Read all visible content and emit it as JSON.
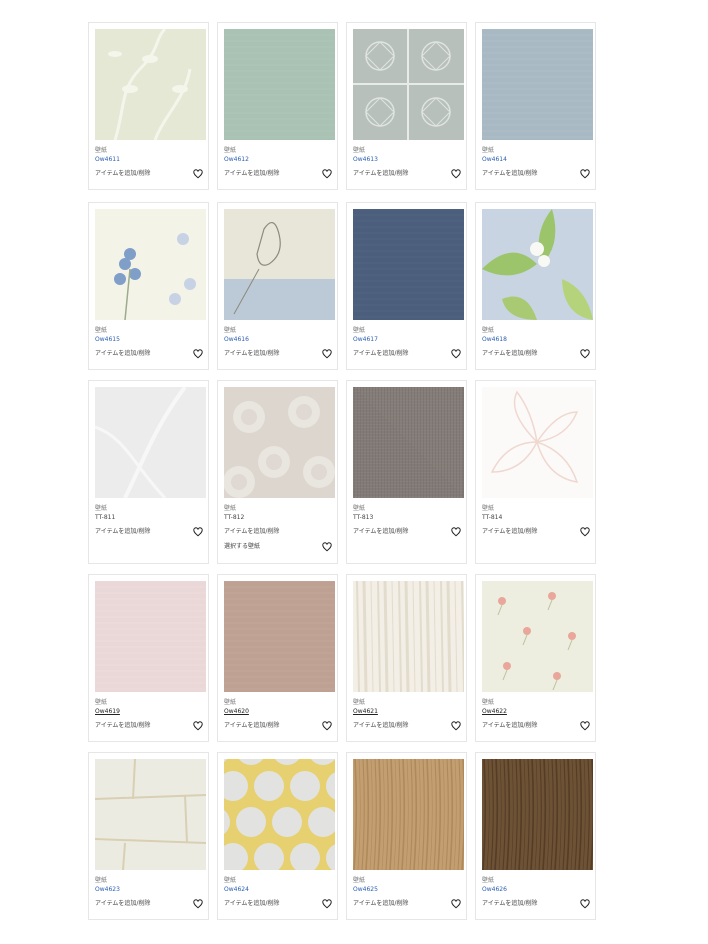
{
  "grid": {
    "rows": [
      [
        {
          "category": "壁紙",
          "code": "Ow4611",
          "name": "アイテムを追加/削除",
          "pattern": "vine",
          "bg": "#e4e8d4",
          "fg": "#f4f6ec"
        },
        {
          "category": "壁紙",
          "code": "Ow4612",
          "name": "アイテムを追加/削除",
          "pattern": "solid-sage",
          "bg": "#a9c2b4",
          "fg": "#b6cdbf"
        },
        {
          "category": "壁紙",
          "code": "Ow4613",
          "name": "アイテムを追加/削除",
          "pattern": "tile",
          "bg": "#b8c0bc",
          "fg": "#dfe4e0"
        },
        {
          "category": "壁紙",
          "code": "Ow4614",
          "name": "アイテムを追加/削除",
          "pattern": "solid-blue",
          "bg": "#a8b9c3",
          "fg": "#b4c4cd"
        }
      ],
      [
        {
          "category": "壁紙",
          "code": "Ow4615",
          "name": "アイテムを追加/削除",
          "pattern": "blue-flower",
          "bg": "#f4f3e8",
          "fg": "#7f9fc9"
        },
        {
          "category": "壁紙",
          "code": "Ow4616",
          "name": "アイテムを追加/削除",
          "pattern": "rabbit",
          "bg": "#e8e6d8",
          "fg": "#a9bcd6"
        },
        {
          "category": "壁紙",
          "code": "Ow4617",
          "name": "アイテムを追加/削除",
          "pattern": "solid-navy",
          "bg": "#4b5f7c",
          "fg": "#55698a"
        },
        {
          "category": "壁紙",
          "code": "Ow4618",
          "name": "アイテムを追加/削除",
          "pattern": "leaf",
          "bg": "#c8d4e2",
          "fg": "#9cc46a"
        }
      ],
      [
        {
          "category": "壁紙",
          "code": "TT-811",
          "name": "アイテムを追加/削除",
          "pattern": "faint",
          "bg": "#ececec",
          "fg": "#f7f7f7"
        },
        {
          "category": "壁紙",
          "code": "TT-812",
          "name": "アイテムを追加/削除",
          "extra": "選択する壁紙",
          "pattern": "damask",
          "bg": "#ddd6cf",
          "fg": "#ece8e2"
        },
        {
          "category": "壁紙",
          "code": "TT-813",
          "name": "アイテムを追加/削除",
          "pattern": "linen",
          "bg": "#807874",
          "fg": "#9a928d"
        },
        {
          "category": "壁紙",
          "code": "TT-814",
          "name": "アイテムを追加/削除",
          "pattern": "line-flower",
          "bg": "#fcfaf8",
          "fg": "#efd8d0"
        }
      ],
      [
        {
          "category": "壁紙",
          "code": "Ow4619",
          "name": "アイテムを追加/削除",
          "pattern": "solid-pink",
          "bg": "#ead8d8",
          "fg": "#f1e2e2"
        },
        {
          "category": "壁紙",
          "code": "Ow4620",
          "name": "アイテムを追加/削除",
          "pattern": "solid-mauve",
          "bg": "#bea193",
          "fg": "#c9ae9f"
        },
        {
          "category": "壁紙",
          "code": "Ow4621",
          "name": "アイテムを追加/削除",
          "pattern": "stripe",
          "bg": "#f3efe6",
          "fg": "#e2dccd"
        },
        {
          "category": "壁紙",
          "code": "Ow4622",
          "name": "アイテムを追加/削除",
          "pattern": "small-flower",
          "bg": "#eeeee0",
          "fg": "#e8a79a"
        }
      ],
      [
        {
          "category": "壁紙",
          "code": "Ow4623",
          "name": "アイテムを追加/削除",
          "pattern": "stone",
          "bg": "#ecebe2",
          "fg": "#d9cfb2"
        },
        {
          "category": "壁紙",
          "code": "Ow4624",
          "name": "アイテムを追加/削除",
          "pattern": "geo",
          "bg": "#e6d070",
          "fg": "#e2e2e0"
        },
        {
          "category": "壁紙",
          "code": "Ow4625",
          "name": "アイテムを追加/削除",
          "pattern": "wood-light",
          "bg": "#c39e70",
          "fg": "#a98456"
        },
        {
          "category": "壁紙",
          "code": "Ow4626",
          "name": "アイテムを追加/削除",
          "pattern": "wood-dark",
          "bg": "#6e5236",
          "fg": "#4e3722"
        }
      ]
    ]
  },
  "icons": {
    "favorite": "heart-icon"
  }
}
